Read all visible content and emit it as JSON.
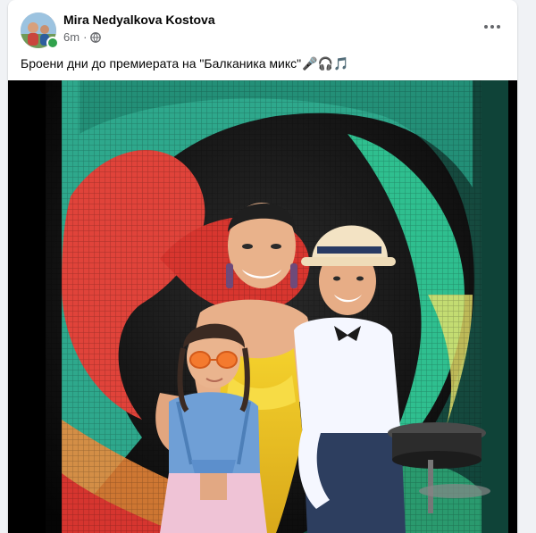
{
  "post": {
    "author": "Mira Nedyalkova Kostova",
    "time": "6m",
    "privacy_icon": "globe-icon",
    "more_icon": "more-options-icon",
    "text": "Броени дни до премиерата на \"Балканика микс\"",
    "emojis": "🎤🎧🎵",
    "photo_description_icon": "post-photo"
  },
  "colors": {
    "author": "#050505",
    "meta": "#65676b",
    "online": "#31a24c",
    "background": "#f0f2f5"
  }
}
